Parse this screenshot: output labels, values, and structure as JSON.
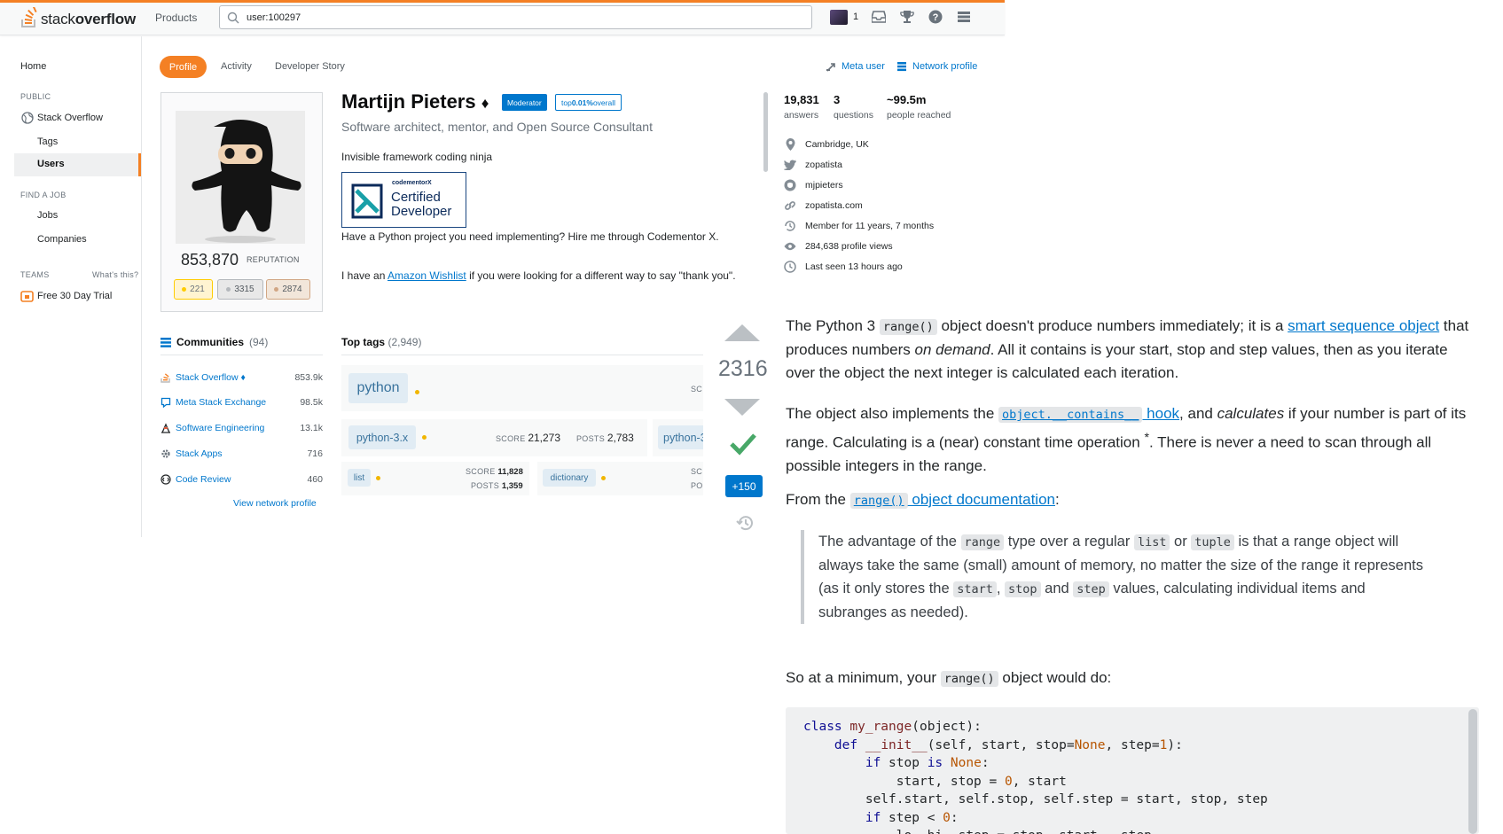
{
  "topbar": {
    "logo_text_light": "stack",
    "logo_text_bold": "overflow",
    "products_label": "Products",
    "search_value": "user:100297",
    "rep_count": "1"
  },
  "leftnav": {
    "home": "Home",
    "public_label": "PUBLIC",
    "stack_overflow": "Stack Overflow",
    "tags": "Tags",
    "users": "Users",
    "find_job_label": "FIND A JOB",
    "jobs": "Jobs",
    "companies": "Companies",
    "teams_label": "TEAMS",
    "whats_this": "What's this?",
    "free_trial": "Free 30 Day Trial"
  },
  "tabs": {
    "profile": "Profile",
    "activity": "Activity",
    "developer_story": "Developer Story",
    "meta_user": "Meta user",
    "network_profile": "Network profile"
  },
  "profile": {
    "reputation": "853,870",
    "reputation_label": "REPUTATION",
    "badges": {
      "gold": "221",
      "silver": "3315",
      "bronze": "2874"
    },
    "name": "Martijn Pieters",
    "diamond": "♦",
    "moderator_badge": "Moderator",
    "top_badge_prefix": "top ",
    "top_badge_strong": "0.01%",
    "top_badge_suffix": " overall",
    "subtitle": "Software architect, mentor, and Open Source Consultant",
    "bio_line1": "Invisible framework coding ninja",
    "codementor_small": "codementorX",
    "codementor_line1": "Certified",
    "codementor_line2": "Developer",
    "bio_line2": "Have a Python project you need implementing? Hire me through Codementor X.",
    "bio_line3_pre": "I have an ",
    "bio_line3_link": "Amazon Wishlist",
    "bio_line3_post": " if you were looking for a different way to say \"thank you\"."
  },
  "stats": {
    "answers_num": "19,831",
    "answers_label": "answers",
    "questions_num": "3",
    "questions_label": "questions",
    "reached_num": "~99.5m",
    "reached_label": "people reached",
    "location": "Cambridge, UK",
    "twitter": "zopatista",
    "github": "mjpieters",
    "website": "zopatista.com",
    "member_for": "Member for 11 years, 7 months",
    "profile_views": "284,638 profile views",
    "last_seen": "Last seen 13 hours ago"
  },
  "communities": {
    "title": "Communities",
    "count": "(94)",
    "items": [
      {
        "name": "Stack Overflow ♦",
        "rep": "853.9k"
      },
      {
        "name": "Meta Stack Exchange",
        "rep": "98.5k"
      },
      {
        "name": "Software Engineering",
        "rep": "13.1k"
      },
      {
        "name": "Stack Apps",
        "rep": "716"
      },
      {
        "name": "Code Review",
        "rep": "460"
      }
    ],
    "view_network": "View network profile"
  },
  "top_tags": {
    "title": "Top tags",
    "count": "(2,949)",
    "python": "python",
    "python_score_cut": "SC",
    "python3": "python-3.x",
    "python3_score_label": "SCORE",
    "python3_score": "21,273",
    "python3_posts_label": "POSTS",
    "python3_posts": "2,783",
    "python3_next": "python-3",
    "list": "list",
    "list_score_label": "SCORE",
    "list_score": "11,828",
    "list_posts_label": "POSTS",
    "list_posts": "1,359",
    "dictionary": "dictionary",
    "dict_score_cut": "SC",
    "dict_posts_cut": "PO"
  },
  "answer": {
    "votes": "2316",
    "bounty": "+150",
    "p1_a": "The Python 3 ",
    "p1_code": "range()",
    "p1_b": " object doesn't produce numbers immediately; it is a ",
    "p1_link": "smart sequence object",
    "p1_c": " that produces numbers ",
    "p1_em": "on demand",
    "p1_d": ". All it contains is your start, stop and step values, then as you iterate over the object the next integer is calculated each iteration.",
    "p2_a": "The object also implements the ",
    "p2_code": "object.__contains__",
    "p2_link": " hook",
    "p2_b": ", and ",
    "p2_em": "calculates",
    "p2_c": " if your number is part of its range. Calculating is a (near) constant time operation ",
    "p2_sup": "*",
    "p2_d": ". There is never a need to scan through all possible integers in the range.",
    "p3_a": "From the ",
    "p3_code": "range()",
    "p3_link": " object documentation",
    "p3_b": ":",
    "q_a": "The advantage of the ",
    "q_code1": "range",
    "q_b": " type over a regular ",
    "q_code2": "list",
    "q_c": " or ",
    "q_code3": "tuple",
    "q_d": " is that a range object will always take the same (small) amount of memory, no matter the size of the range it represents (as it only stores the ",
    "q_code4": "start",
    "q_e": ", ",
    "q_code5": "stop",
    "q_f": " and ",
    "q_code6": "step",
    "q_g": " values, calculating individual items and subranges as needed).",
    "p4_a": "So at a minimum, your ",
    "p4_code": "range()",
    "p4_b": " object would do:"
  }
}
